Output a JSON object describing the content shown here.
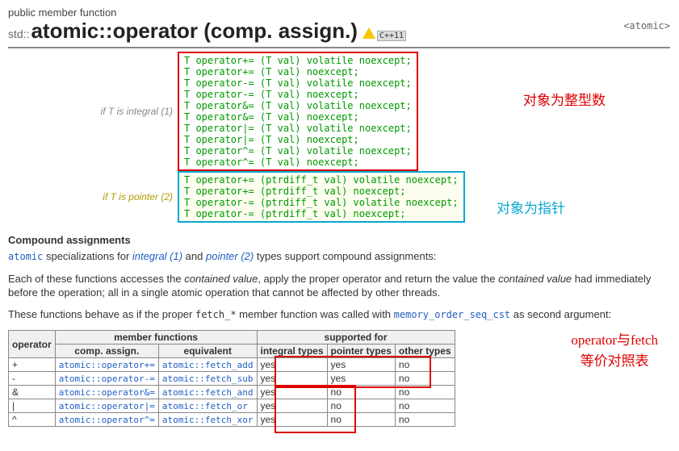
{
  "header": {
    "kicker": "public member function",
    "namespace": "std::",
    "title": "atomic::operator (comp. assign.)",
    "tag": "<atomic>",
    "cpp_badge": "C++11"
  },
  "codebox": {
    "label_int": "if T is integral (1)",
    "label_ptr": "if T is pointer (2)",
    "int_lines": "T operator+= (T val) volatile noexcept;\nT operator+= (T val) noexcept;\nT operator-= (T val) volatile noexcept;\nT operator-= (T val) noexcept;\nT operator&= (T val) volatile noexcept;\nT operator&= (T val) noexcept;\nT operator|= (T val) volatile noexcept;\nT operator|= (T val) noexcept;\nT operator^= (T val) volatile noexcept;\nT operator^= (T val) noexcept;",
    "ptr_lines": "T operator+= (ptrdiff_t val) volatile noexcept;\nT operator+= (ptrdiff_t val) noexcept;\nT operator-= (ptrdiff_t val) volatile noexcept;\nT operator-= (ptrdiff_t val) noexcept;"
  },
  "annotations": {
    "int_note": "对象为整型数",
    "ptr_note": "对象为指针",
    "table_note": "operator与fetch\n等价对照表"
  },
  "section": {
    "h": "Compound assignments",
    "p1a": " specializations for ",
    "p1_atomic": "atomic",
    "p1_integral": "integral (1)",
    "p1b": " and ",
    "p1_pointer": "pointer (2)",
    "p1c": " types support compound assignments:",
    "p2a": "Each of these functions accesses the ",
    "p2_cv": "contained value",
    "p2b": ", apply the proper operator and return the value the ",
    "p2_cv2": "contained value",
    "p2c": " had immediately before the operation; all in a single atomic operation that cannot be affected by other threads.",
    "p3a": "These functions behave as if the proper ",
    "p3_code": "fetch_*",
    "p3b": " member function was called with ",
    "p3_code2": "memory_order_seq_cst",
    "p3c": " as second argument:"
  },
  "table": {
    "head": {
      "op": "operator",
      "mf": "member functions",
      "sf": "supported for",
      "ca": "comp. assign.",
      "eq": "equivalent",
      "it": "integral types",
      "pt": "pointer types",
      "ot": "other types"
    },
    "rows": [
      {
        "op": "+",
        "ca": "atomic::operator+=",
        "eq": "atomic::fetch_add",
        "it": "yes",
        "pt": "yes",
        "ot": "no"
      },
      {
        "op": "-",
        "ca": "atomic::operator-=",
        "eq": "atomic::fetch_sub",
        "it": "yes",
        "pt": "yes",
        "ot": "no"
      },
      {
        "op": "&",
        "ca": "atomic::operator&=",
        "eq": "atomic::fetch_and",
        "it": "yes",
        "pt": "no",
        "ot": "no"
      },
      {
        "op": "|",
        "ca": "atomic::operator|=",
        "eq": "atomic::fetch_or",
        "it": "yes",
        "pt": "no",
        "ot": "no"
      },
      {
        "op": "^",
        "ca": "atomic::operator^=",
        "eq": "atomic::fetch_xor",
        "it": "yes",
        "pt": "no",
        "ot": "no"
      }
    ]
  }
}
